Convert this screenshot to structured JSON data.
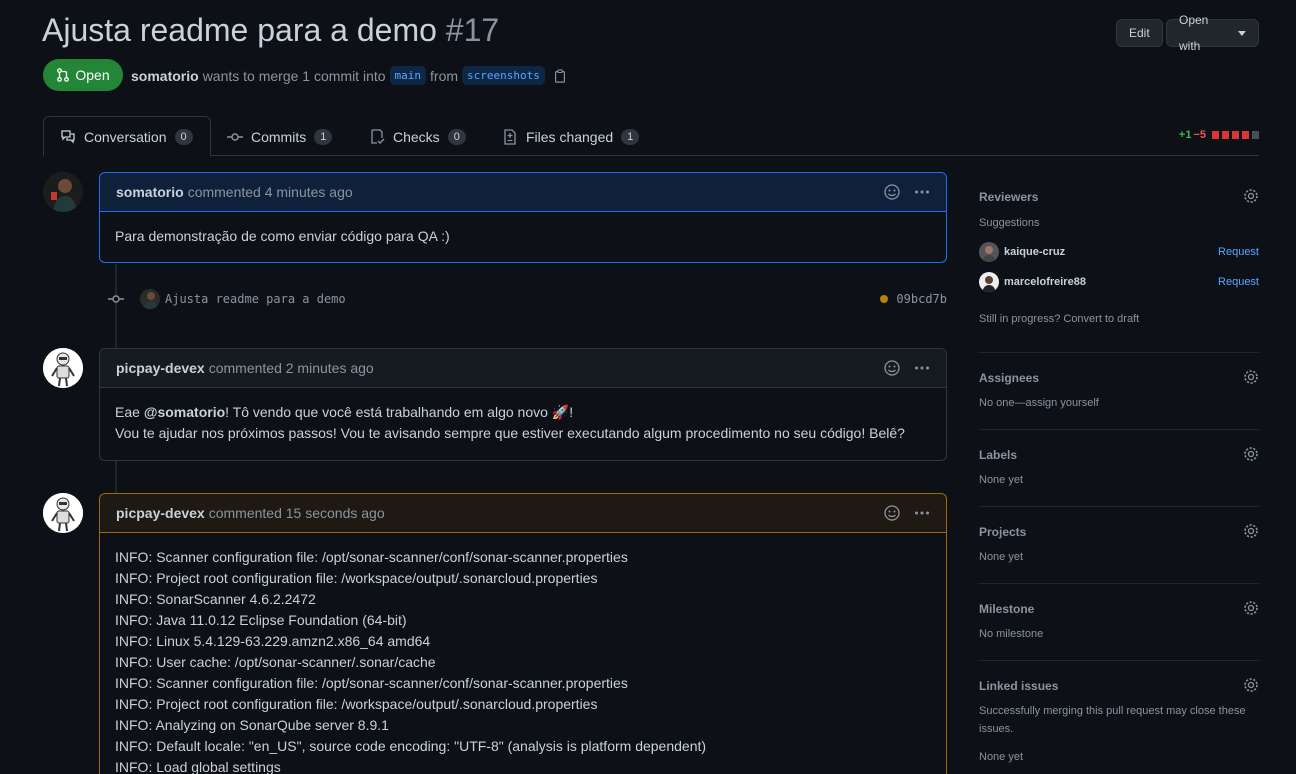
{
  "pr": {
    "title": "Ajusta readme para a demo",
    "number": "#17",
    "state": "Open",
    "author": "somatorio",
    "meta_text": "wants to merge 1 commit into",
    "base_branch": "main",
    "from_text": "from",
    "head_branch": "screenshots"
  },
  "header_buttons": {
    "edit": "Edit",
    "open_with": "Open with"
  },
  "tabs": [
    {
      "label": "Conversation",
      "count": "0"
    },
    {
      "label": "Commits",
      "count": "1"
    },
    {
      "label": "Checks",
      "count": "0"
    },
    {
      "label": "Files changed",
      "count": "1"
    }
  ],
  "diffstat": {
    "additions": "+1",
    "deletions": "−5"
  },
  "comments": [
    {
      "author": "somatorio",
      "time": "commented 4 minutes ago",
      "body": "Para demonstração de como enviar código para QA :)"
    },
    {
      "author": "picpay-devex",
      "time": "commented 2 minutes ago",
      "line1_pre": "Eae ",
      "mention": "@somatorio",
      "line1_post": "! Tô vendo que você está trabalhando em algo novo 🚀!",
      "line2": "Vou te ajudar nos próximos passos! Vou te avisando sempre que estiver executando algum procedimento no seu código! Belê?"
    },
    {
      "author": "picpay-devex",
      "time": "commented 15 seconds ago",
      "lines": [
        "INFO: Scanner configuration file: /opt/sonar-scanner/conf/sonar-scanner.properties",
        "INFO: Project root configuration file: /workspace/output/.sonarcloud.properties",
        "INFO: SonarScanner 4.6.2.2472",
        "INFO: Java 11.0.12 Eclipse Foundation (64-bit)",
        "INFO: Linux 5.4.129-63.229.amzn2.x86_64 amd64",
        "INFO: User cache: /opt/sonar-scanner/.sonar/cache",
        "INFO: Scanner configuration file: /opt/sonar-scanner/conf/sonar-scanner.properties",
        "INFO: Project root configuration file: /workspace/output/.sonarcloud.properties",
        "INFO: Analyzing on SonarQube server 8.9.1",
        "INFO: Default locale: \"en_US\", source code encoding: \"UTF-8\" (analysis is platform dependent)",
        "INFO: Load global settings"
      ]
    }
  ],
  "commit": {
    "message": "Ajusta readme para a demo",
    "sha": "09bcd7b"
  },
  "sidebar": {
    "reviewers": {
      "title": "Reviewers",
      "suggestions": "Suggestions",
      "people": [
        {
          "name": "kaique-cruz",
          "action": "Request"
        },
        {
          "name": "marcelofreire88",
          "action": "Request"
        }
      ],
      "draft": "Still in progress? Convert to draft"
    },
    "assignees": {
      "title": "Assignees",
      "text": "No one—assign yourself"
    },
    "labels": {
      "title": "Labels",
      "text": "None yet"
    },
    "projects": {
      "title": "Projects",
      "text": "None yet"
    },
    "milestone": {
      "title": "Milestone",
      "text": "No milestone"
    },
    "linked": {
      "title": "Linked issues",
      "text": "Successfully merging this pull request may close these issues.",
      "none": "None yet"
    }
  },
  "colors": {
    "open_green": "#238636",
    "link_blue": "#58a6ff",
    "add": "#3fb950",
    "del": "#f85149"
  }
}
